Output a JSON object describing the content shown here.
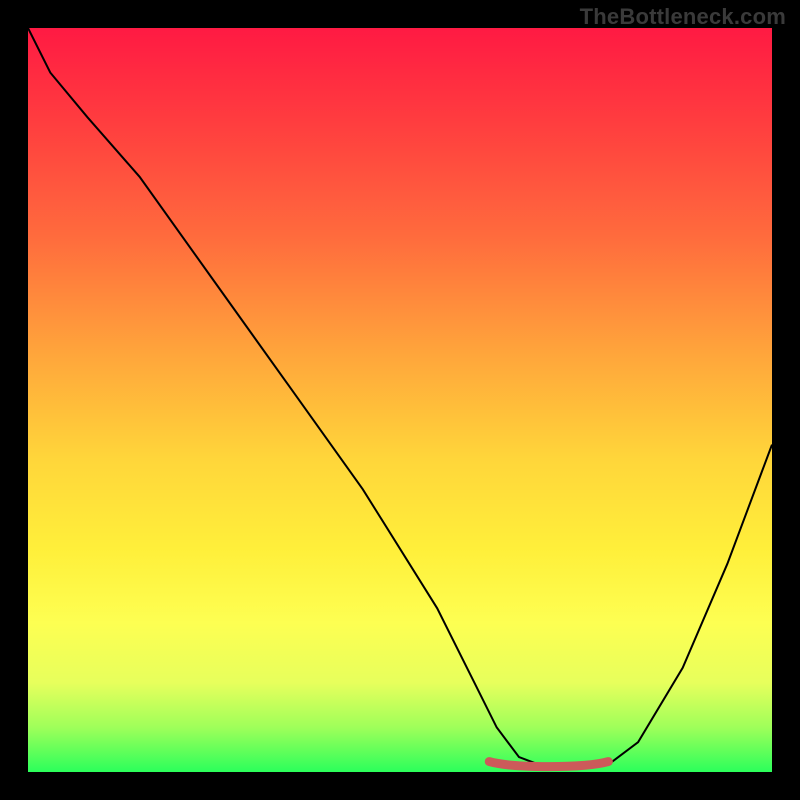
{
  "watermark": "TheBottleneck.com",
  "colors": {
    "page_bg": "#000000",
    "gradient_top": "#ff1a43",
    "gradient_bottom": "#2bff5b",
    "curve": "#000000",
    "marker": "#cc5a5a"
  },
  "chart_data": {
    "type": "line",
    "title": "",
    "xlabel": "",
    "ylabel": "",
    "xlim": [
      0,
      100
    ],
    "ylim": [
      0,
      100
    ],
    "grid": false,
    "note": "x is abstract horizontal position (0–100); y is abstract bottleneck value (0 best at green bottom, 100 worst at red top). Values are visually estimated from the image.",
    "series": [
      {
        "name": "bottleneck-curve",
        "x": [
          0,
          3,
          8,
          15,
          25,
          35,
          45,
          55,
          60,
          63,
          66,
          70,
          74,
          78,
          82,
          88,
          94,
          100
        ],
        "y": [
          100,
          94,
          88,
          80,
          66,
          52,
          38,
          22,
          12,
          6,
          2,
          0.5,
          0.5,
          1,
          4,
          14,
          28,
          44
        ]
      }
    ],
    "highlight_range": {
      "name": "optimal-zone",
      "x_start": 62,
      "x_end": 78,
      "y": 1
    }
  }
}
